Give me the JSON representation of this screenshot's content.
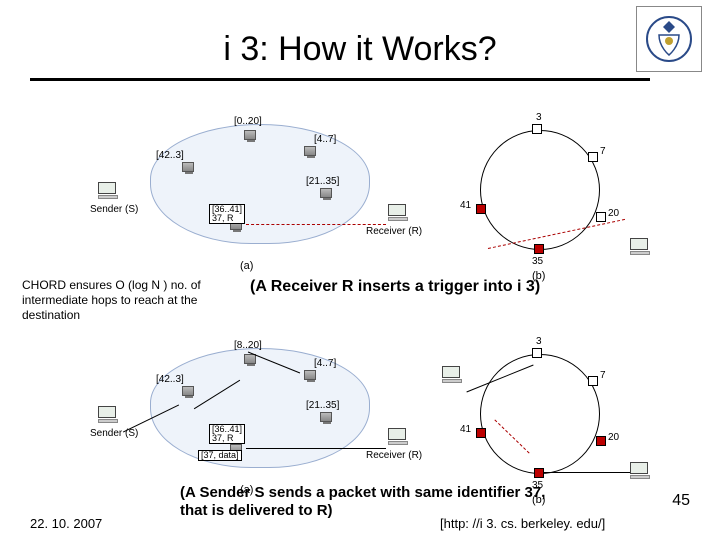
{
  "slide": {
    "title": "i 3: How it Works?",
    "date": "22. 10. 2007",
    "url_citation": "[http: //i 3. cs. berkeley. edu/]",
    "page_number": "45"
  },
  "captions": {
    "chord_note": "CHORD ensures O (log N ) no. of intermediate hops to reach at the destination",
    "receiver_caption": "(A Receiver R inserts a trigger into i 3)",
    "sender_caption": "(A Sender S sends a packet with same identifier 37, that is delivered to R)"
  },
  "fig_labels": {
    "a": "(a)",
    "b": "(b)"
  },
  "actors": {
    "sender": "Sender (S)",
    "receiver": "Receiver (R)"
  },
  "triggers": {
    "r_trigger_line1": "[36..41]",
    "r_trigger_line2": "37, R",
    "send_trigger_line1": "[36..41]",
    "send_trigger_line2": "37, R",
    "packet_box": "[37, data]"
  },
  "cloud_ids": {
    "n0": "[0..20]",
    "n1": "[4..7]",
    "n2": "[42..3]",
    "n3": "[21..35]",
    "n4_top": "[8..20]",
    "n4_bottom": "[8..20]"
  },
  "ring_labels": {
    "n3": "3",
    "n7": "7",
    "n20": "20",
    "n35": "35",
    "n41": "41"
  },
  "icons": {
    "crest": "university-crest-icon"
  }
}
